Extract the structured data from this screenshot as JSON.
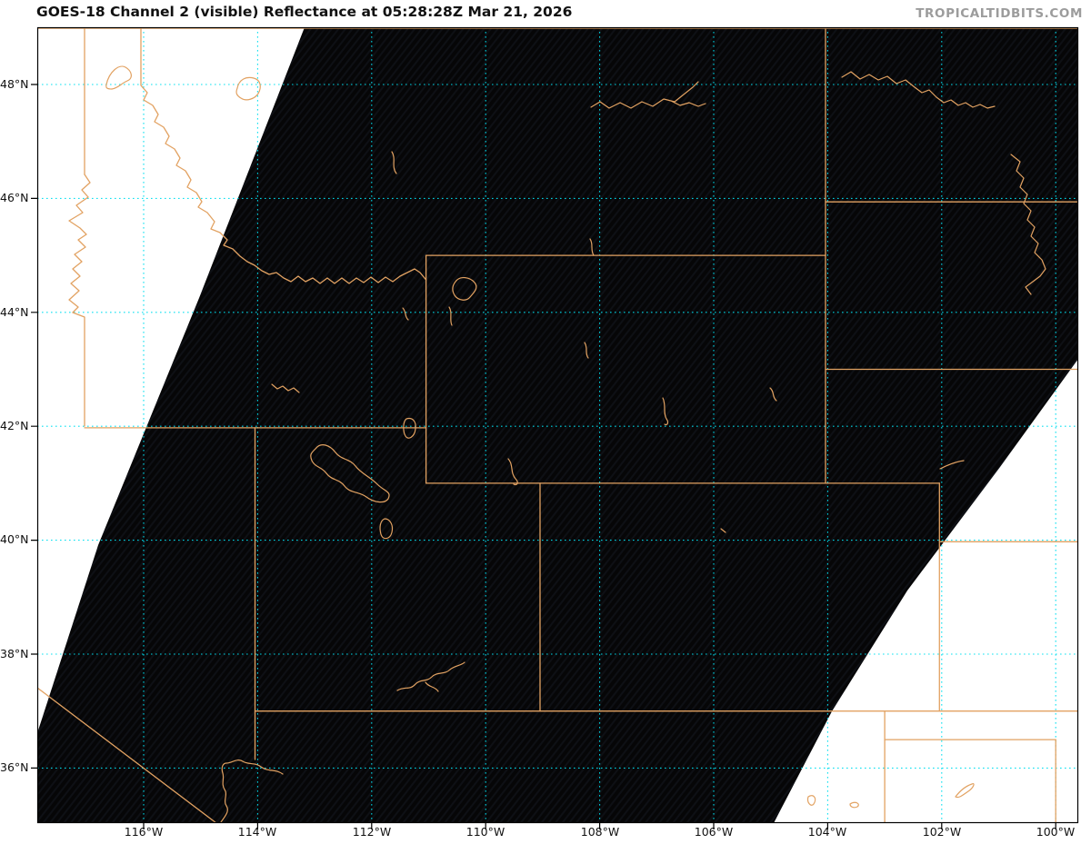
{
  "title": "GOES-18 Channel 2 (visible) Reflectance at 05:28:28Z Mar 21, 2026",
  "watermark": "TROPICALTIDBITS.COM",
  "map": {
    "satellite_product": "GOES-18 Channel 2 (visible) Reflectance",
    "valid_time": "05:28:28Z Mar 21, 2026",
    "lat_ticks": [
      "48°N",
      "46°N",
      "44°N",
      "42°N",
      "40°N",
      "38°N",
      "36°N"
    ],
    "lon_ticks": [
      "116°W",
      "114°W",
      "112°W",
      "110°W",
      "108°W",
      "106°W",
      "104°W",
      "102°W",
      "100°W"
    ],
    "colors": {
      "night_sector_fill": "#070708",
      "no_data_fill": "#ffffff",
      "state_border_lines": "#e2a262",
      "grid_lines": "#00dff0",
      "frame": "#000000",
      "title_text": "#111111",
      "watermark_text": "#9c9c9c",
      "tick_label_text": "#111111"
    }
  }
}
